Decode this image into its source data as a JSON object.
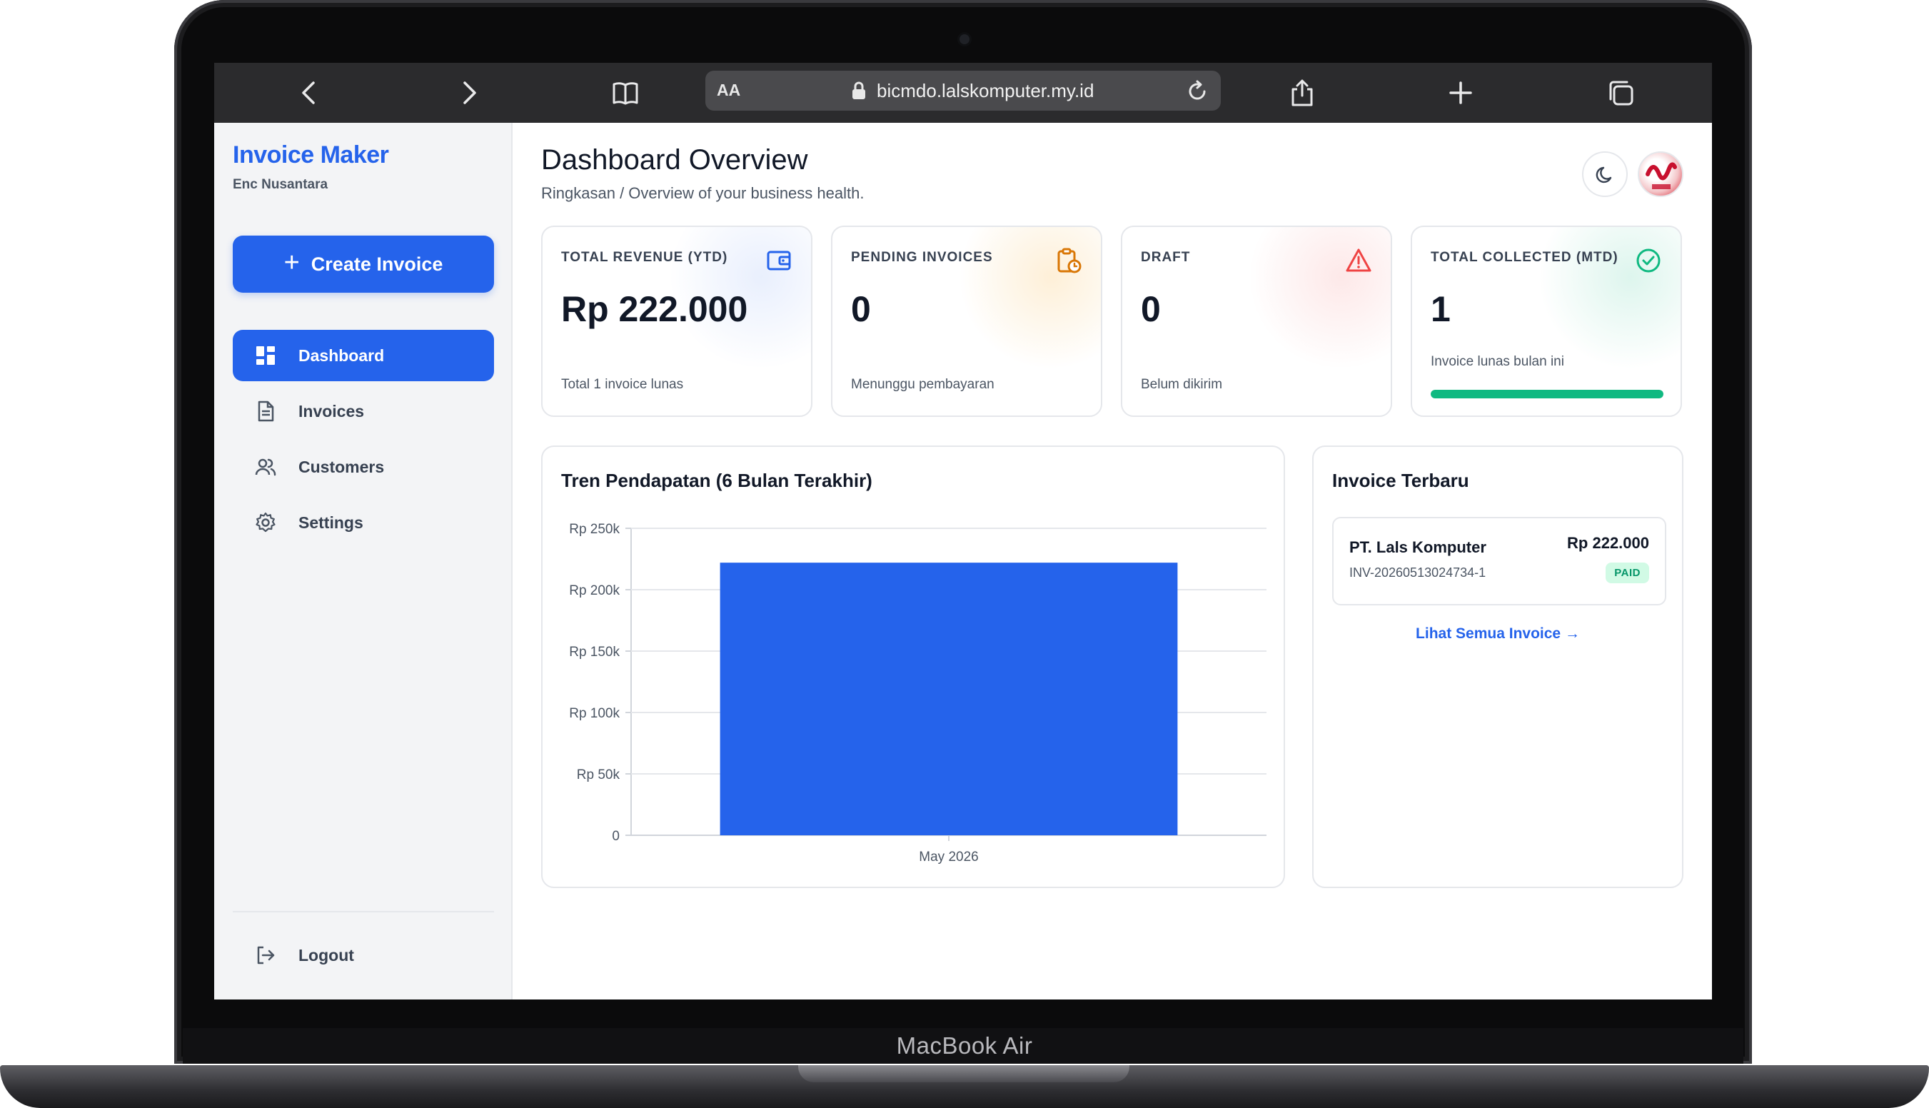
{
  "device": {
    "label": "MacBook Air"
  },
  "browser": {
    "url_aa": "AA",
    "url": "bicmdo.lalskomputer.my.id"
  },
  "sidebar": {
    "brand": "Invoice Maker",
    "org": "Enc Nusantara",
    "create_label": "Create Invoice",
    "items": [
      {
        "label": "Dashboard",
        "icon": "dashboard-icon",
        "active": true
      },
      {
        "label": "Invoices",
        "icon": "document-icon"
      },
      {
        "label": "Customers",
        "icon": "users-icon"
      },
      {
        "label": "Settings",
        "icon": "gear-icon"
      }
    ],
    "logout_label": "Logout"
  },
  "header": {
    "title": "Dashboard Overview",
    "subtitle": "Ringkasan / Overview of your business health."
  },
  "stats": [
    {
      "label": "TOTAL REVENUE (YTD)",
      "value": "Rp 222.000",
      "desc": "Total 1 invoice lunas",
      "icon": "wallet-icon",
      "color": "#2563eb"
    },
    {
      "label": "PENDING INVOICES",
      "value": "0",
      "desc": "Menunggu pembayaran",
      "icon": "clipboard-clock-icon",
      "color": "#d97706"
    },
    {
      "label": "DRAFT",
      "value": "0",
      "desc": "Belum dikirim",
      "icon": "warning-icon",
      "color": "#ef4444"
    },
    {
      "label": "TOTAL COLLECTED (MTD)",
      "value": "1",
      "desc": "Invoice lunas bulan ini",
      "icon": "check-circle-icon",
      "color": "#10b981",
      "progress": 1.0
    }
  ],
  "chart": {
    "title": "Tren Pendapatan (6 Bulan Terakhir)"
  },
  "chart_data": {
    "type": "bar",
    "categories": [
      "May 2026"
    ],
    "values": [
      222000
    ],
    "ylim": [
      0,
      250000
    ],
    "yticks": [
      0,
      50000,
      100000,
      150000,
      200000,
      250000
    ],
    "ytick_labels": [
      "0",
      "Rp 50k",
      "Rp 100k",
      "Rp 150k",
      "Rp 200k",
      "Rp 250k"
    ],
    "grid": true,
    "color": "#2563eb"
  },
  "recent": {
    "title": "Invoice Terbaru",
    "items": [
      {
        "customer": "PT. Lals Komputer",
        "number": "INV-20260513024734-1",
        "amount": "Rp 222.000",
        "status": "PAID"
      }
    ],
    "see_all": "Lihat Semua Invoice →"
  }
}
